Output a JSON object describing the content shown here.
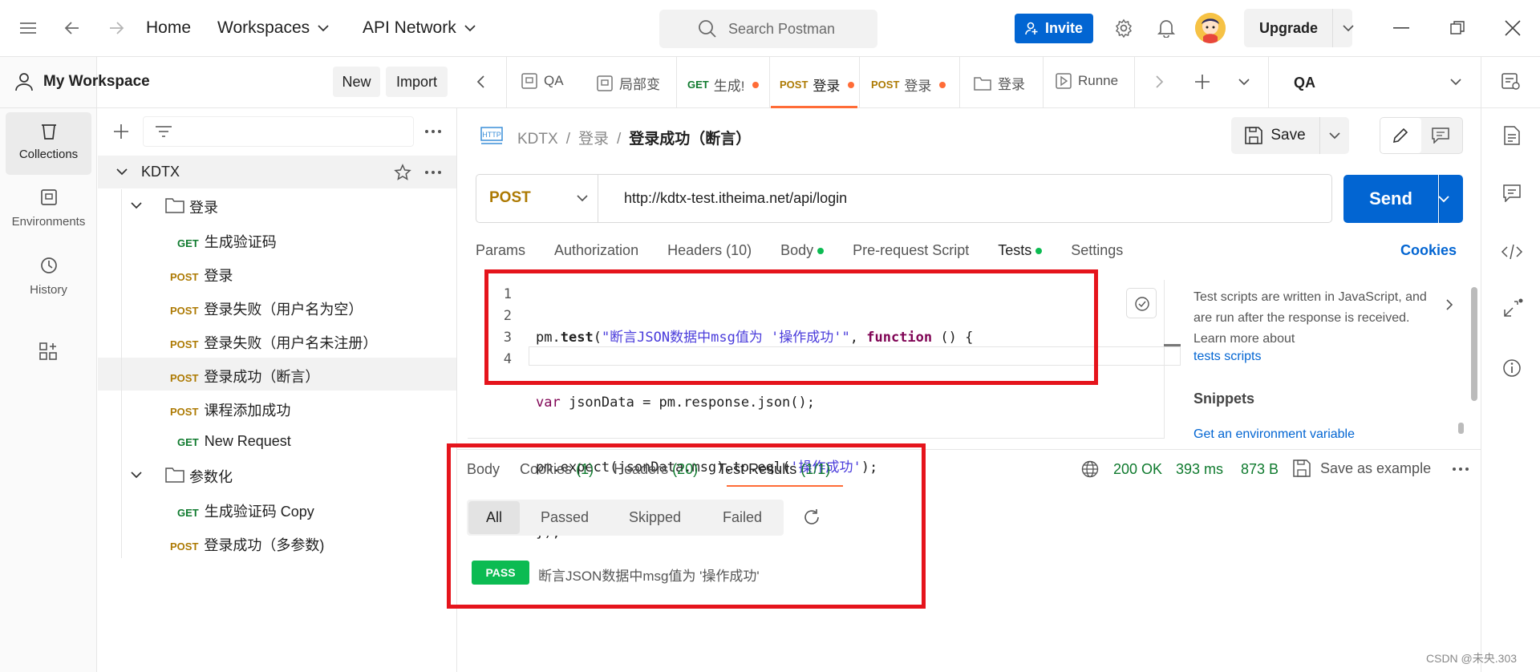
{
  "topbar": {
    "home": "Home",
    "workspaces": "Workspaces",
    "api_network": "API Network",
    "search_placeholder": "Search Postman",
    "invite": "Invite",
    "upgrade": "Upgrade"
  },
  "workspace": {
    "name": "My Workspace",
    "new": "New",
    "import": "Import"
  },
  "rail": [
    {
      "label": "Collections"
    },
    {
      "label": "Environments"
    },
    {
      "label": "History"
    }
  ],
  "tree": {
    "collection": "KDTX",
    "folder1": "登录",
    "folder2": "参数化",
    "items": [
      {
        "method": "GET",
        "name": "生成验证码"
      },
      {
        "method": "POST",
        "name": "登录"
      },
      {
        "method": "POST",
        "name": "登录失败（用户名为空）"
      },
      {
        "method": "POST",
        "name": "登录失败（用户名未注册）"
      },
      {
        "method": "POST",
        "name": "登录成功（断言）"
      },
      {
        "method": "POST",
        "name": "课程添加成功"
      },
      {
        "method": "GET",
        "name": "New Request"
      },
      {
        "method": "GET",
        "name": "生成验证码 Copy"
      },
      {
        "method": "POST",
        "name": "登录成功（多参数)"
      }
    ]
  },
  "tabs": [
    {
      "method": "",
      "label": "QA"
    },
    {
      "method": "",
      "label": "局部变"
    },
    {
      "method": "GET",
      "label": "生成!"
    },
    {
      "method": "POST",
      "label": "登录"
    },
    {
      "method": "POST",
      "label": "登录"
    },
    {
      "method": "",
      "label": "登录"
    },
    {
      "method": "",
      "label": "Runne"
    }
  ],
  "environment": "QA",
  "breadcrumb": {
    "part1": "KDTX",
    "part2": "登录",
    "current": "登录成功（断言）",
    "sep": "/",
    "http": "HTTP"
  },
  "save": "Save",
  "request": {
    "method": "POST",
    "url": "http://kdtx-test.itheima.net/api/login",
    "send": "Send"
  },
  "req_tabs": {
    "params": "Params",
    "authorization": "Authorization",
    "headers": "Headers (10)",
    "body": "Body",
    "prerequest": "Pre-request Script",
    "tests": "Tests",
    "settings": "Settings",
    "cookies": "Cookies"
  },
  "code": {
    "line_numbers": [
      "1",
      "2",
      "3",
      "4"
    ],
    "l1": {
      "obj": "pm",
      "dot": ".",
      "fn": "test",
      "open": "(",
      "str": "\"断言JSON数据中msg值为 '操作成功'\"",
      "comma": ", ",
      "kw": "function",
      "rest": " () {"
    },
    "l2": {
      "kw": "var",
      "rest": " jsonData = pm.response.json();"
    },
    "l3": {
      "pre": "pm.expect(jsonData.msg).to.eql(",
      "str": "'操作成功'",
      "post": ");"
    },
    "l4": "});"
  },
  "side_help": {
    "text": "Test scripts are written in JavaScript, and are run after the response is received. Learn more about",
    "link": "tests scripts",
    "snippets": "Snippets",
    "snippet1": "Get an environment variable"
  },
  "response": {
    "tabs": {
      "body": "Body",
      "cookies": "Cookies",
      "cookies_count": "(1)",
      "headers": "Headers",
      "headers_count": "(20)",
      "tests": "Test Results",
      "tests_count": "(1/1)"
    },
    "status": "200 OK",
    "time": "393 ms",
    "size": "873 B",
    "save_example": "Save as example",
    "filters": [
      "All",
      "Passed",
      "Skipped",
      "Failed"
    ],
    "result_badge": "PASS",
    "result_text": "断言JSON数据中msg值为 '操作成功'"
  },
  "watermark": "CSDN @未央.303",
  "colors": {
    "accent": "#ff6c37",
    "send": "#0265d2",
    "highlight_box": "#e5141c",
    "pass": "#0cbb52"
  }
}
